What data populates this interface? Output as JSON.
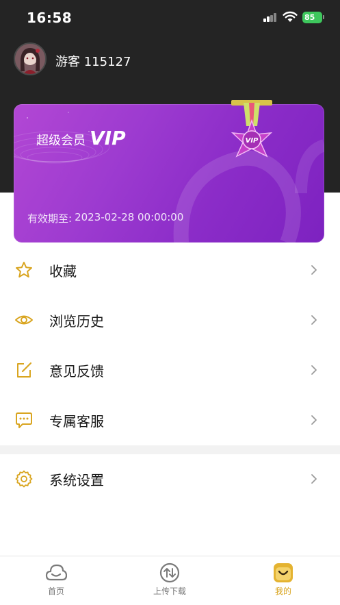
{
  "status_bar": {
    "time": "16:58",
    "battery": "85"
  },
  "profile": {
    "username": "游客 115127"
  },
  "vip_card": {
    "title_prefix": "超级会员",
    "title_vip": "VIP",
    "medal_text": "VIP",
    "expire_label": "有效期至:",
    "expire_value": "2023-02-28 00:00:00"
  },
  "menu": [
    {
      "label": "收藏",
      "icon": "star-icon"
    },
    {
      "label": "浏览历史",
      "icon": "eye-icon"
    },
    {
      "label": "意见反馈",
      "icon": "edit-icon"
    },
    {
      "label": "专属客服",
      "icon": "chat-icon"
    },
    {
      "label": "系统设置",
      "icon": "gear-icon"
    }
  ],
  "tabs": [
    {
      "label": "首页",
      "icon": "home-cloud-icon",
      "active": false
    },
    {
      "label": "上传下载",
      "icon": "transfer-icon",
      "active": false
    },
    {
      "label": "我的",
      "icon": "profile-smile-icon",
      "active": true
    }
  ],
  "colors": {
    "accent": "#d9a520",
    "header_bg": "#242424",
    "vip_gradient_start": "#b247d4",
    "vip_gradient_end": "#7d22c0",
    "battery_green": "#3ec75d"
  }
}
